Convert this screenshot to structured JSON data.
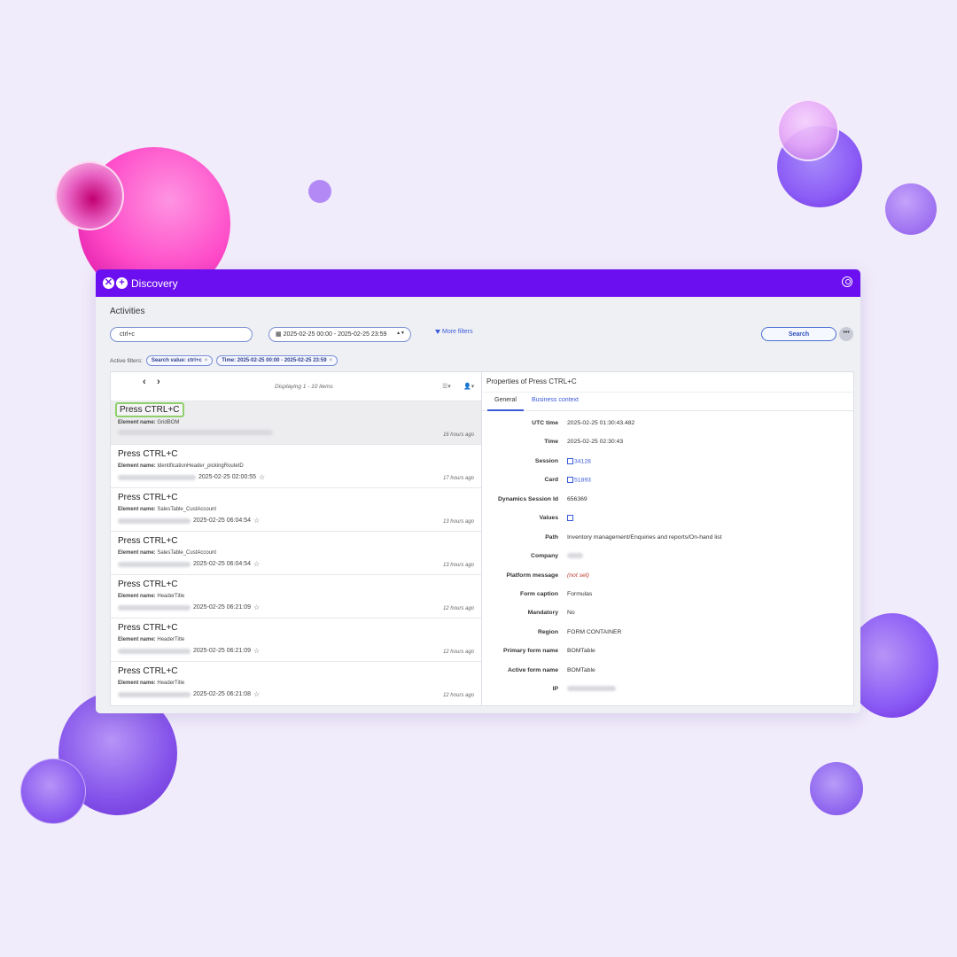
{
  "app": {
    "title": "Discovery"
  },
  "page": {
    "title": "Activities"
  },
  "filters": {
    "search_value": "ctrl+c",
    "date_range": "2025-02-25 00:00 - 2025-02-25 23:59",
    "more_filters_label": "More filters",
    "search_button": "Search",
    "more_button": "•••",
    "active_label": "Active filters:",
    "chips": [
      "Search value: ctrl+c",
      "Time: 2025-02-25 00:00 - 2025-02-25 23:59"
    ]
  },
  "list": {
    "displaying": "Displaying 1 - 10 items",
    "items": [
      {
        "title": "Press CTRL+C",
        "element_label": "Element name:",
        "element": "GridBOM",
        "time": "",
        "ago": "16 hours ago"
      },
      {
        "title": "Press CTRL+C",
        "element_label": "Element name:",
        "element": "IdentificationHeader_pickingRouteID",
        "time": "2025-02-25 02:00:55",
        "ago": "17 hours ago"
      },
      {
        "title": "Press CTRL+C",
        "element_label": "Element name:",
        "element": "SalesTable_CustAccount",
        "time": "2025-02-25 06:04:54",
        "ago": "13 hours ago"
      },
      {
        "title": "Press CTRL+C",
        "element_label": "Element name:",
        "element": "SalesTable_CustAccount",
        "time": "2025-02-25 06:04:54",
        "ago": "13 hours ago"
      },
      {
        "title": "Press CTRL+C",
        "element_label": "Element name:",
        "element": "HeaderTitle",
        "time": "2025-02-25 06:21:09",
        "ago": "12 hours ago"
      },
      {
        "title": "Press CTRL+C",
        "element_label": "Element name:",
        "element": "HeaderTitle",
        "time": "2025-02-25 06:21:09",
        "ago": "12 hours ago"
      },
      {
        "title": "Press CTRL+C",
        "element_label": "Element name:",
        "element": "HeaderTitle",
        "time": "2025-02-25 06:21:08",
        "ago": "12 hours ago"
      }
    ]
  },
  "properties": {
    "title": "Properties of Press CTRL+C",
    "tabs": [
      "General",
      "Business context"
    ],
    "rows": [
      {
        "label": "UTC time",
        "value": "2025-02-25 01:30:43.482"
      },
      {
        "label": "Time",
        "value": "2025-02-25 02:30:43"
      },
      {
        "label": "Session",
        "value": "34128"
      },
      {
        "label": "Card",
        "value": "51893"
      },
      {
        "label": "Dynamics Session Id",
        "value": "656369"
      },
      {
        "label": "Values",
        "value": ""
      },
      {
        "label": "Path",
        "value": "Inventory management/Enquiries and reports/On-hand list"
      },
      {
        "label": "Company",
        "value": ""
      },
      {
        "label": "Platform message",
        "value": "(not set)"
      },
      {
        "label": "Form caption",
        "value": "Formulas"
      },
      {
        "label": "Mandatory",
        "value": "No"
      },
      {
        "label": "Region",
        "value": "FORM CONTAINER"
      },
      {
        "label": "Primary form name",
        "value": "BOMTable"
      },
      {
        "label": "Active form name",
        "value": "BOMTable"
      },
      {
        "label": "IP",
        "value": ""
      }
    ]
  }
}
